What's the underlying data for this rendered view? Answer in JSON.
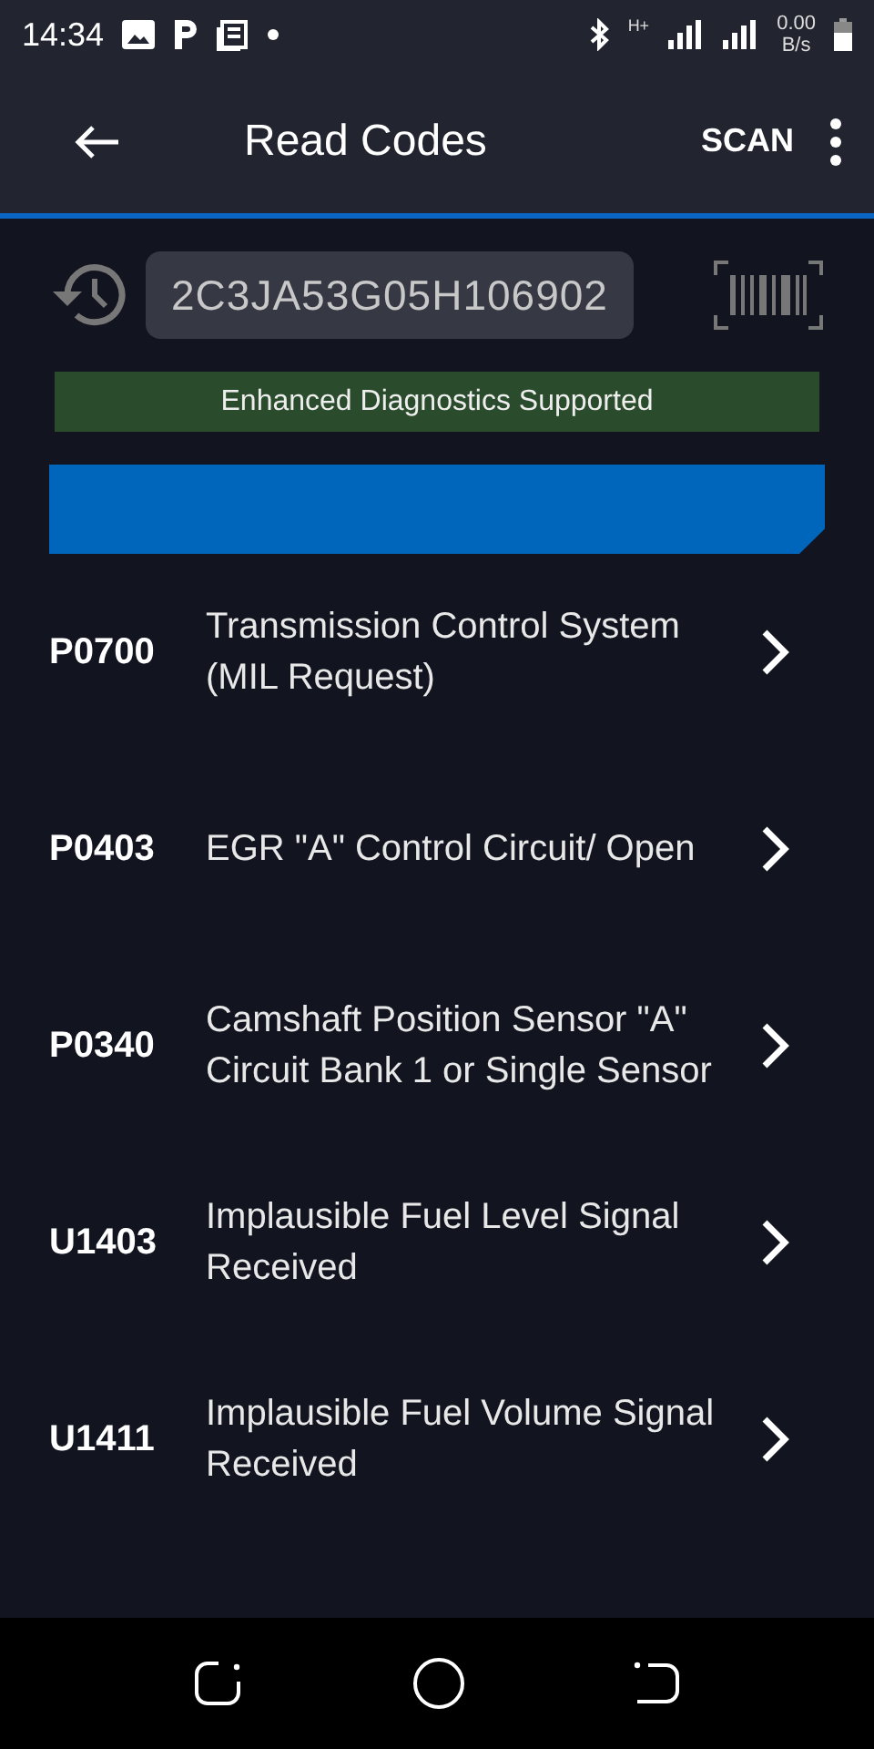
{
  "status_bar": {
    "time": "14:34",
    "network": "H+",
    "speed_value": "0.00",
    "speed_unit": "B/s"
  },
  "app_bar": {
    "title": "Read Codes",
    "action": "SCAN"
  },
  "vin": {
    "value": "2C3JA53G05H106902"
  },
  "notice": "Enhanced Diagnostics Supported",
  "codes": [
    {
      "code": "P0700",
      "description": "Transmission Control System (MIL Request)"
    },
    {
      "code": "P0403",
      "description": "EGR \"A\" Control Circuit/ Open"
    },
    {
      "code": "P0340",
      "description": "Camshaft Position Sensor \"A\" Circuit Bank 1 or Single Sensor"
    },
    {
      "code": "U1403",
      "description": "Implausible Fuel Level Signal Received"
    },
    {
      "code": "U1411",
      "description": "Implausible Fuel Volume Signal Received"
    }
  ]
}
